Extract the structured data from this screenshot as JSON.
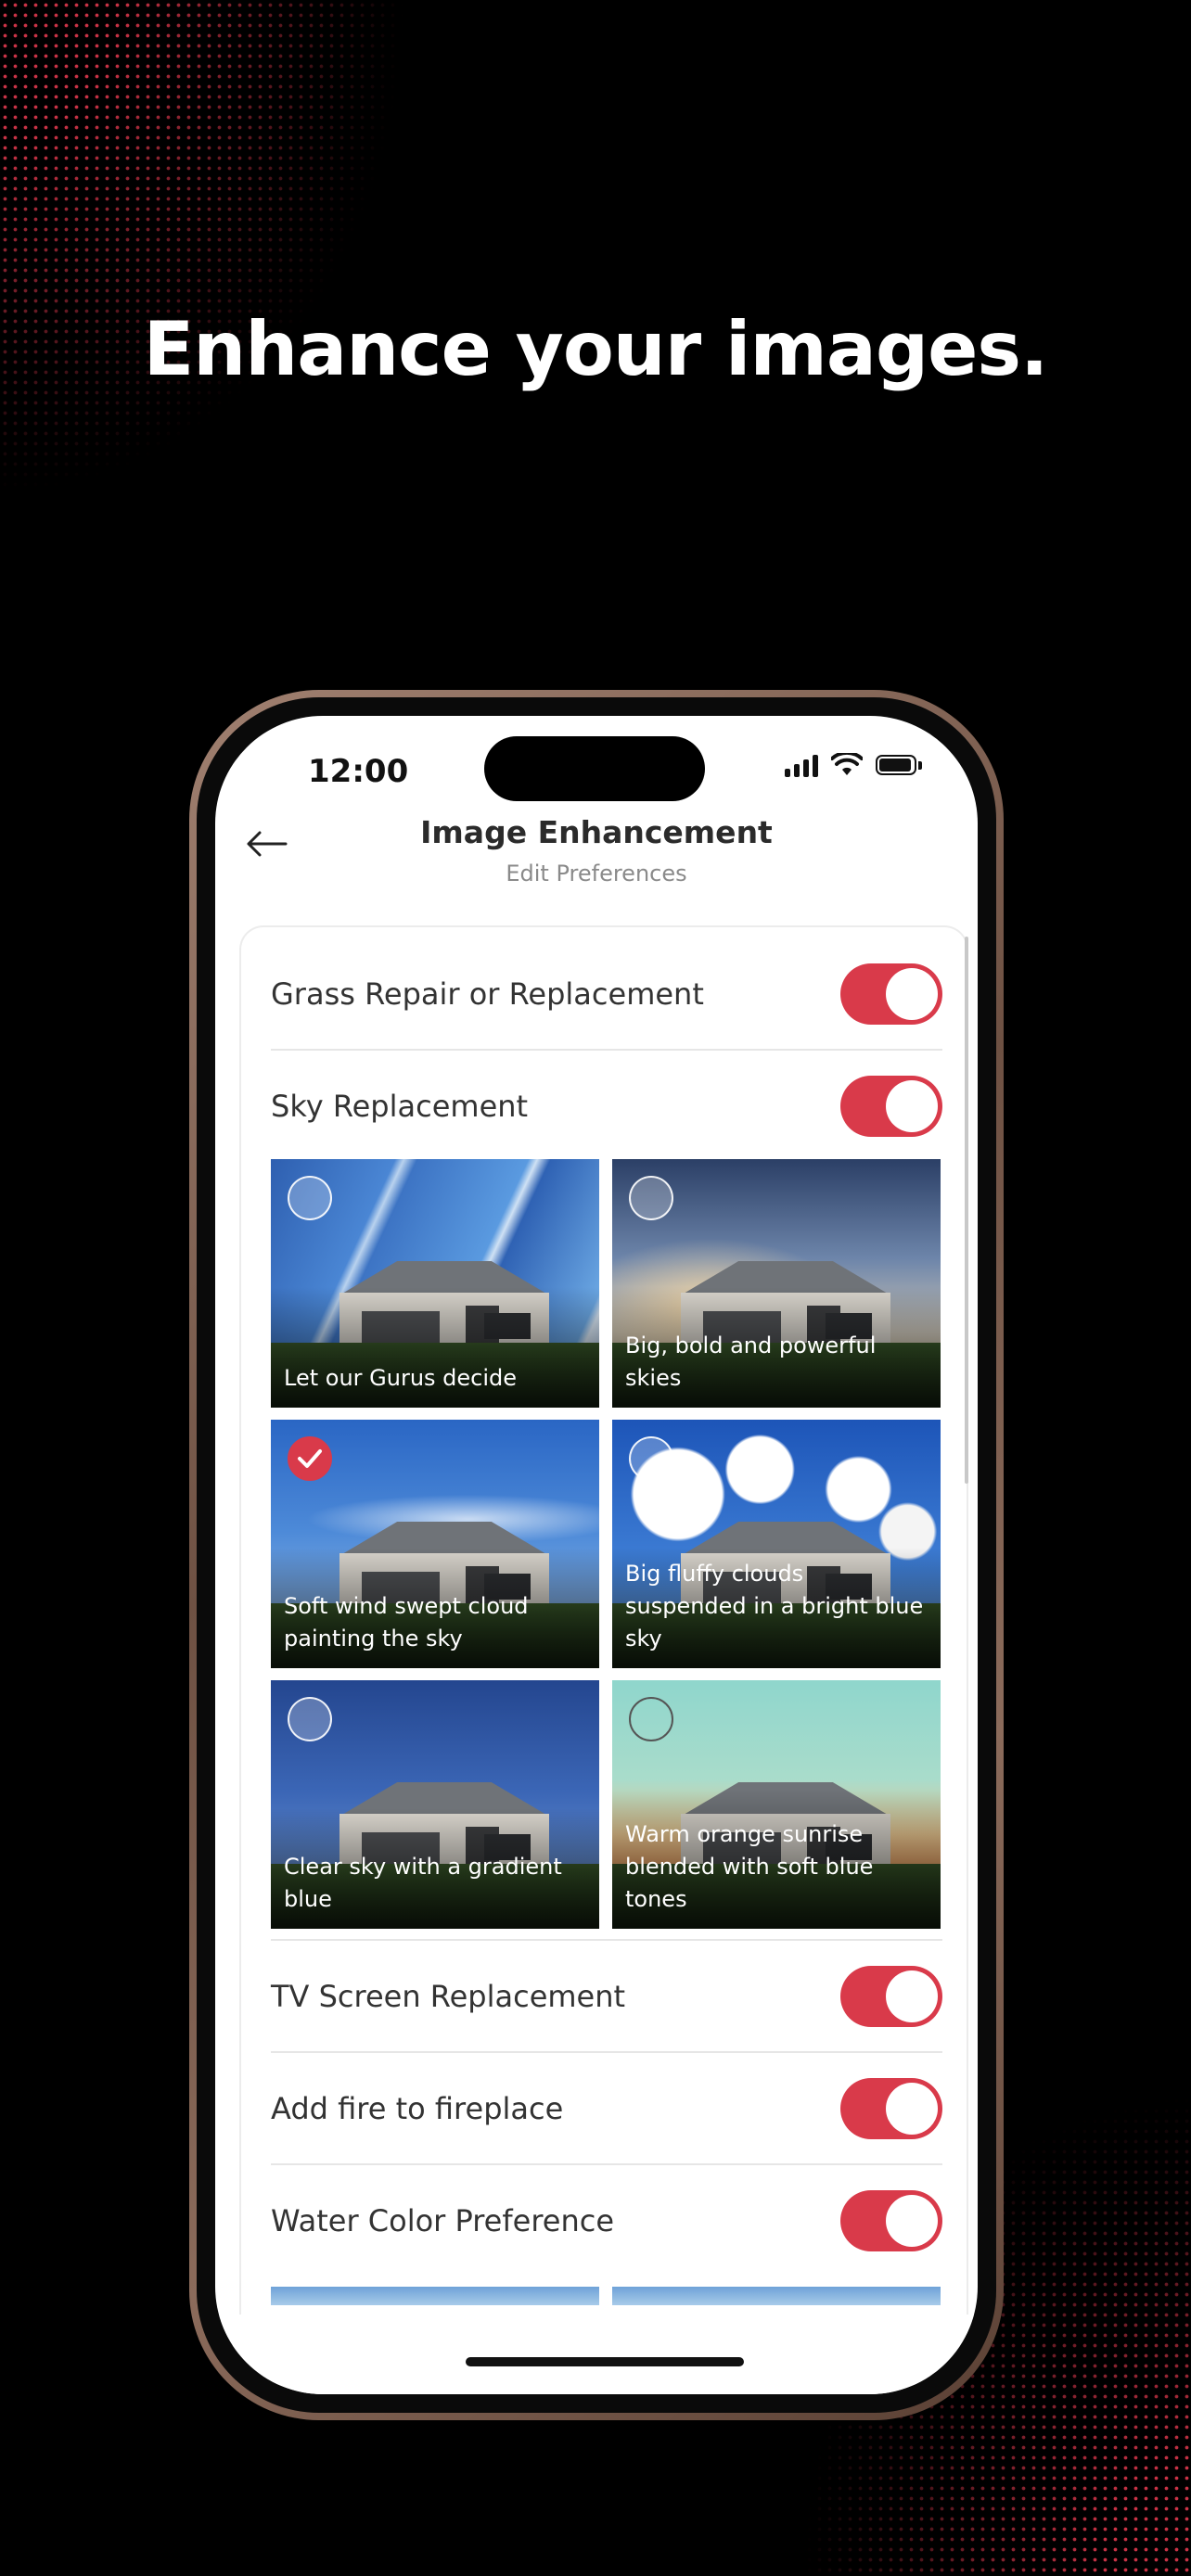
{
  "headline": "Enhance your images.",
  "status_bar": {
    "time": "12:00"
  },
  "nav": {
    "title": "Image Enhancement",
    "subtitle": "Edit Preferences"
  },
  "colors": {
    "accent": "#d93a4a",
    "background": "#000000",
    "screen": "#ffffff"
  },
  "preferences": [
    {
      "label": "Grass Repair or Replacement",
      "enabled": true
    },
    {
      "label": "Sky Replacement",
      "enabled": true
    },
    {
      "label": "TV Screen Replacement",
      "enabled": true
    },
    {
      "label": "Add fire to fireplace",
      "enabled": true
    },
    {
      "label": "Water Color Preference",
      "enabled": true
    }
  ],
  "sky_options": [
    {
      "caption": "Let our Gurus decide",
      "selected": false
    },
    {
      "caption": "Big, bold and powerful skies",
      "selected": false
    },
    {
      "caption": "Soft wind swept cloud painting the sky",
      "selected": true
    },
    {
      "caption": "Big fluffy clouds suspended in a bright blue sky",
      "selected": false
    },
    {
      "caption": "Clear sky with a gradient blue",
      "selected": false
    },
    {
      "caption": "Warm orange sunrise blended with soft blue tones",
      "selected": false
    }
  ]
}
